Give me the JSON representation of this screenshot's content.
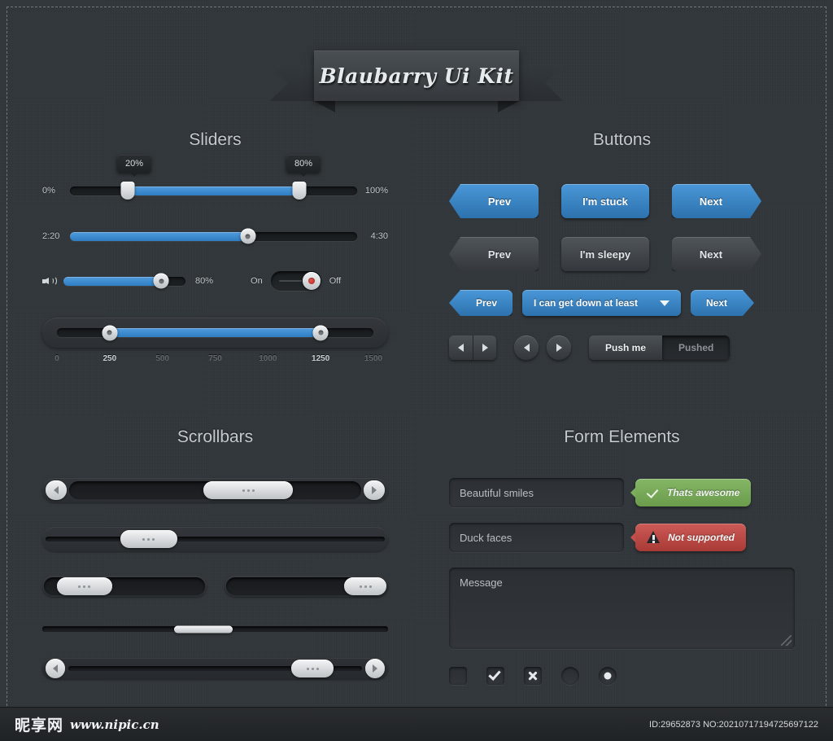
{
  "ribbon": {
    "title": "Blaubarry Ui Kit"
  },
  "sections": {
    "sliders": "Sliders",
    "buttons": "Buttons",
    "scrollbars": "Scrollbars",
    "form": "Form Elements"
  },
  "sliders": {
    "range": {
      "min_label": "0%",
      "max_label": "100%",
      "low_tooltip": "20%",
      "high_tooltip": "80%",
      "low_value": 20,
      "high_value": 80
    },
    "time": {
      "start_label": "2:20",
      "end_label": "4:30",
      "value": 62
    },
    "volume": {
      "icon": "speaker-icon",
      "value_label": "80%",
      "value": 80
    },
    "toggle": {
      "on_label": "On",
      "off_label": "Off",
      "state": "off"
    },
    "scale": {
      "ticks": [
        "0",
        "250",
        "500",
        "750",
        "1000",
        "1250",
        "1500"
      ],
      "active_ticks": [
        "250",
        "1250"
      ],
      "low_value": 250,
      "high_value": 1250,
      "min": 0,
      "max": 1500
    }
  },
  "buttons": {
    "row_blue": {
      "prev": "Prev",
      "middle": "I'm stuck",
      "next": "Next"
    },
    "row_gray": {
      "prev": "Prev",
      "middle": "I'm sleepy",
      "next": "Next"
    },
    "row_dropdown": {
      "prev": "Prev",
      "select_value": "I can get down at least",
      "next": "Next"
    },
    "row_controls": {
      "push_off": "Push me",
      "push_on": "Pushed"
    }
  },
  "form": {
    "field1_value": "Beautiful smiles",
    "field1_status": "Thats awesome",
    "field2_value": "Duck faces",
    "field2_status": "Not supported",
    "message_placeholder": "Message"
  },
  "colors": {
    "accent_blue": "#3c8ed0",
    "success_green": "#7cae5d",
    "error_red": "#c2514d",
    "background": "#31363a"
  },
  "footer": {
    "logo": "昵享网",
    "url": "www.nipic.cn",
    "id_text": "ID:29652873 NO:20210717194725697122"
  }
}
